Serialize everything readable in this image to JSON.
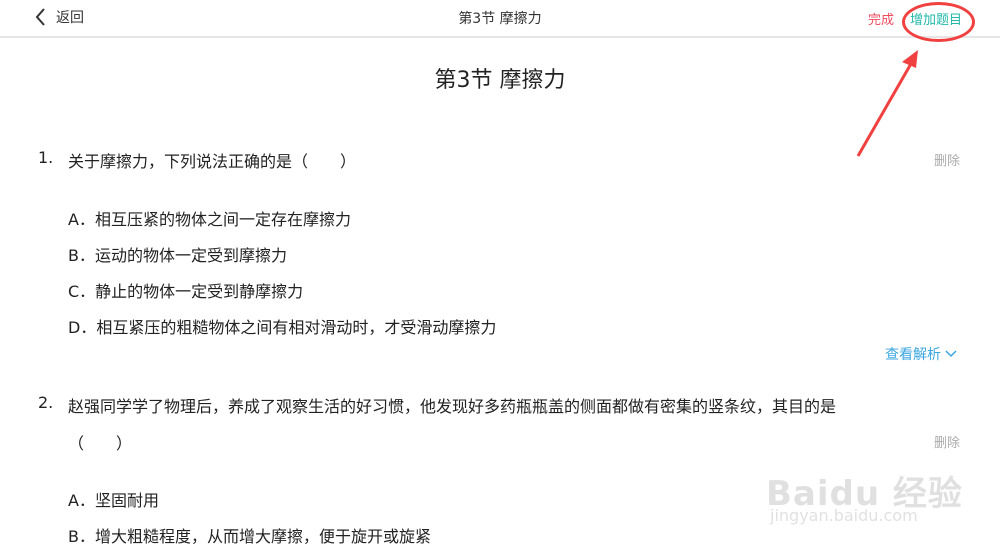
{
  "header": {
    "back_label": "返回",
    "title": "第3节 摩擦力",
    "done_label": "完成",
    "add_label": "增加题目"
  },
  "page_title": "第3节 摩擦力",
  "questions": [
    {
      "number": "1.",
      "text": "关于摩擦力，下列说法正确的是（　　）",
      "delete_label": "删除",
      "options": [
        "A．相互压紧的物体之间一定存在摩擦力",
        "B．运动的物体一定受到摩擦力",
        "C．静止的物体一定受到静摩擦力",
        "D．相互紧压的粗糙物体之间有相对滑动时，才受滑动摩擦力"
      ],
      "analysis_label": "查看解析"
    },
    {
      "number": "2.",
      "text_line1": "赵强同学学了物理后，养成了观察生活的好习惯，他发现好多药瓶瓶盖的侧面都做有密集的竖条纹，其目的是",
      "text_line2": "（　　）",
      "delete_label": "删除",
      "options": [
        "A．坚固耐用",
        "B．增大粗糙程度，从而增大摩擦，便于旋开或旋紧"
      ]
    }
  ],
  "watermark": {
    "logo": "Baidu 经验",
    "sub": "jingyan.baidu.com"
  },
  "annotation_color": "#f04040"
}
